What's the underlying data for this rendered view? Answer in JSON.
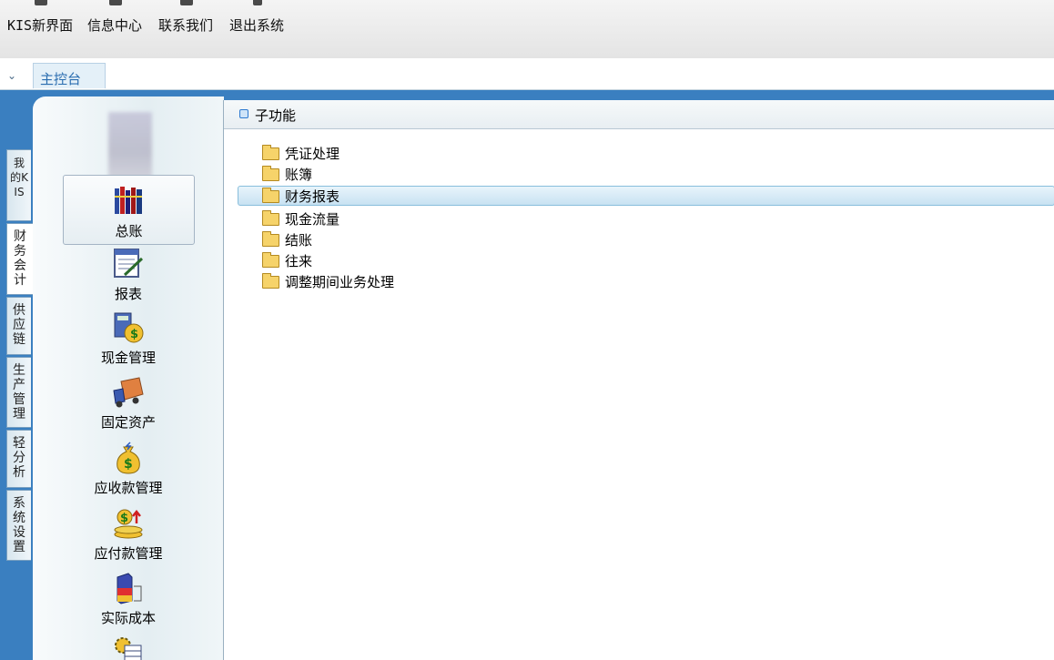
{
  "toolbar": {
    "items": [
      {
        "label": "KIS新界面"
      },
      {
        "label": "信息中心"
      },
      {
        "label": "联系我们"
      },
      {
        "label": "退出系统"
      }
    ]
  },
  "tabs": {
    "chevron": "⌄",
    "main": "主控台"
  },
  "side_tabs": [
    {
      "label": "我的KIS"
    },
    {
      "label": "财务会计"
    },
    {
      "label": "供应链"
    },
    {
      "label": "生产管理"
    },
    {
      "label": "轻分析"
    },
    {
      "label": "系统设置"
    }
  ],
  "modules": [
    {
      "label": "总账",
      "icon": "ledger-books-icon"
    },
    {
      "label": "报表",
      "icon": "report-sheet-icon"
    },
    {
      "label": "现金管理",
      "icon": "cash-calculator-icon"
    },
    {
      "label": "固定资产",
      "icon": "delivery-truck-icon"
    },
    {
      "label": "应收款管理",
      "icon": "money-bag-icon"
    },
    {
      "label": "应付款管理",
      "icon": "payment-stack-icon"
    },
    {
      "label": "实际成本",
      "icon": "cost-blocks-icon"
    },
    {
      "label": "",
      "icon": "gear-sheet-icon"
    }
  ],
  "content": {
    "header": "子功能",
    "items": [
      {
        "label": "凭证处理"
      },
      {
        "label": "账簿"
      },
      {
        "label": "财务报表"
      },
      {
        "label": "现金流量"
      },
      {
        "label": "结账"
      },
      {
        "label": "往来"
      },
      {
        "label": "调整期间业务处理"
      }
    ],
    "selected_index": 2
  }
}
